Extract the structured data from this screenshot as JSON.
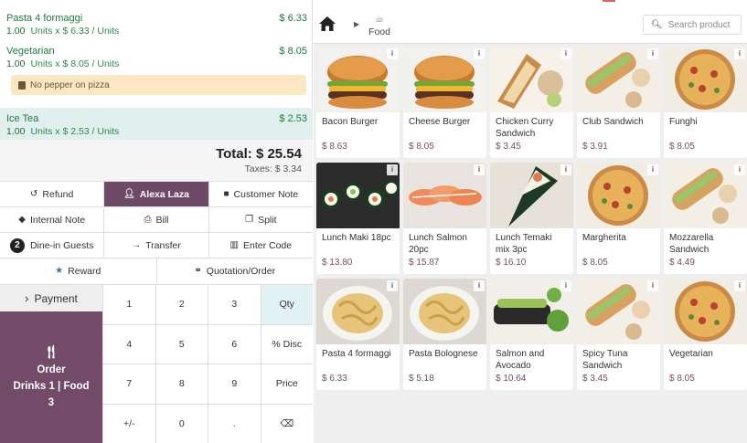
{
  "orderlines": [
    {
      "name": "Pasta 4 formaggi",
      "price": "$ 6.33",
      "qty": "1.00",
      "unit_text": "Units x $ 6.33 / Units"
    },
    {
      "name": "Vegetarian",
      "price": "$ 8.05",
      "qty": "1.00",
      "unit_text": "Units x $ 8.05 / Units",
      "note": "No pepper on pizza"
    },
    {
      "name": "Ice Tea",
      "price": "$ 2.53",
      "qty": "1.00",
      "unit_text": "Units x $ 2.53 / Units"
    }
  ],
  "totals": {
    "total": "Total: $ 25.54",
    "taxes": "Taxes: $ 3.34"
  },
  "controls": {
    "refund": "Refund",
    "customer": "Alexa Laza",
    "customer_note": "Customer Note",
    "internal_note": "Internal Note",
    "bill": "Bill",
    "split": "Split",
    "guests_count": "2",
    "guests": "Dine-in Guests",
    "transfer": "Transfer",
    "enter_code": "Enter Code",
    "reward": "Reward",
    "quotation": "Quotation/Order"
  },
  "payment": "Payment",
  "order_button": {
    "line1": "Order",
    "line2": "Drinks 1 | Food",
    "line3": "3"
  },
  "numpad": [
    "1",
    "2",
    "3",
    "Qty",
    "4",
    "5",
    "6",
    "% Disc",
    "7",
    "8",
    "9",
    "Price",
    "+/-",
    "0",
    ".",
    "⌫"
  ],
  "category": "Food",
  "search_placeholder": "Search product",
  "colors": {
    "accent": "#714b67",
    "green": "#217a3d",
    "selected_line": "#e1f0ee",
    "note": "#fbe8c2"
  },
  "products": [
    {
      "name": "Bacon Burger",
      "price": "$ 8.63",
      "img": "burger"
    },
    {
      "name": "Cheese Burger",
      "price": "$ 8.05",
      "img": "burger"
    },
    {
      "name": "Chicken Curry Sandwich",
      "price": "$ 3.45",
      "img": "sandwich"
    },
    {
      "name": "Club Sandwich",
      "price": "$ 3.91",
      "img": "baguette"
    },
    {
      "name": "Funghi",
      "price": "$ 8.05",
      "img": "pizza"
    },
    {
      "name": "Lunch Maki 18pc",
      "price": "$ 13.80",
      "img": "maki"
    },
    {
      "name": "Lunch Salmon 20pc",
      "price": "$ 15.87",
      "img": "salmon"
    },
    {
      "name": "Lunch Temaki mix 3pc",
      "price": "$ 16.10",
      "img": "temaki"
    },
    {
      "name": "Margherita",
      "price": "$ 8.05",
      "img": "pizza"
    },
    {
      "name": "Mozzarella Sandwich",
      "price": "$ 4.49",
      "img": "baguette"
    },
    {
      "name": "Pasta 4 formaggi",
      "price": "$ 6.33",
      "img": "pasta"
    },
    {
      "name": "Pasta Bolognese",
      "price": "$ 5.18",
      "img": "pasta"
    },
    {
      "name": "Salmon and Avocado",
      "price": "$ 10.64",
      "img": "avocado"
    },
    {
      "name": "Spicy Tuna Sandwich",
      "price": "$ 3.45",
      "img": "baguette"
    },
    {
      "name": "Vegetarian",
      "price": "$ 8.05",
      "img": "pizza"
    }
  ]
}
